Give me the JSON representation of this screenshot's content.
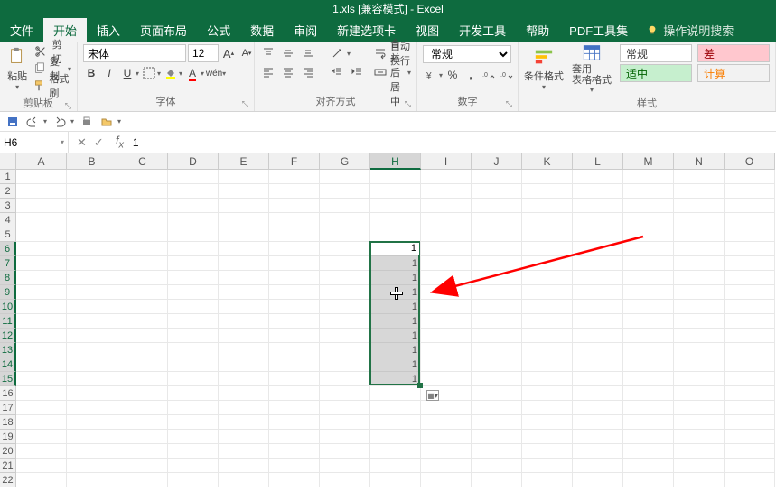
{
  "title": "1.xls  [兼容模式]  -  Excel",
  "tabs": [
    "文件",
    "开始",
    "插入",
    "页面布局",
    "公式",
    "数据",
    "审阅",
    "新建选项卡",
    "视图",
    "开发工具",
    "帮助",
    "PDF工具集"
  ],
  "active_tab_index": 1,
  "tell_me": "操作说明搜索",
  "clipboard": {
    "cut": "剪切",
    "copy": "复制",
    "painter": "格式刷",
    "paste": "粘贴",
    "label": "剪贴板"
  },
  "font": {
    "name": "宋体",
    "size": "12",
    "label": "字体"
  },
  "align": {
    "wrap": "自动换行",
    "merge": "合并后居中",
    "label": "对齐方式"
  },
  "number": {
    "format": "常规",
    "label": "数字"
  },
  "styles": {
    "cond": "条件格式",
    "table": "套用\n表格格式",
    "normal": "常规",
    "bad": "差",
    "good": "适中",
    "calc": "计算",
    "label": "样式"
  },
  "namebox": "H6",
  "formula_value": "1",
  "columns": [
    "A",
    "B",
    "C",
    "D",
    "E",
    "F",
    "G",
    "H",
    "I",
    "J",
    "K",
    "L",
    "M",
    "N",
    "O"
  ],
  "sel_col_index": 7,
  "rows_total": 22,
  "sel_row_start": 6,
  "sel_row_end": 15,
  "cell_values": {
    "H6": "1",
    "H7": "1",
    "H8": "1",
    "H9": "1",
    "H10": "1",
    "H11": "1",
    "H12": "1",
    "H13": "1",
    "H14": "1",
    "H15": "1"
  },
  "colors": {
    "brand": "#0e6b3f",
    "selection": "#217346",
    "arrow": "#ff0000"
  },
  "chart_data": null
}
